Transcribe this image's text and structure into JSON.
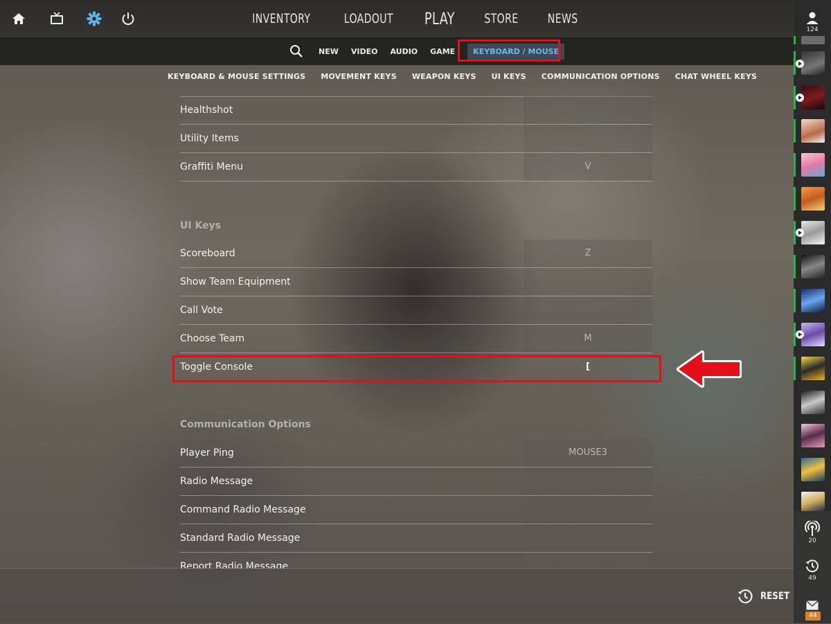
{
  "top_nav": {
    "items": [
      {
        "label": "INVENTORY"
      },
      {
        "label": "LOADOUT"
      },
      {
        "label": "PLAY"
      },
      {
        "label": "STORE"
      },
      {
        "label": "NEWS"
      }
    ],
    "left_icons": [
      "home-icon",
      "tv-icon",
      "gear-icon",
      "power-icon"
    ]
  },
  "settings_tabs": {
    "search_icon": "search-icon",
    "items": [
      "NEW",
      "VIDEO",
      "AUDIO",
      "GAME"
    ],
    "active": "KEYBOARD / MOUSE"
  },
  "sub_nav": [
    "KEYBOARD & MOUSE SETTINGS",
    "MOVEMENT KEYS",
    "WEAPON KEYS",
    "UI KEYS",
    "COMMUNICATION OPTIONS",
    "CHAT WHEEL KEYS"
  ],
  "rows_group1": [
    {
      "label": "Healthshot",
      "key": ""
    },
    {
      "label": "Utility Items",
      "key": ""
    },
    {
      "label": "Graffiti Menu",
      "key": "V"
    }
  ],
  "section_ui": "UI Keys",
  "rows_ui": [
    {
      "label": "Scoreboard",
      "key": "Z"
    },
    {
      "label": "Show Team Equipment",
      "key": ""
    },
    {
      "label": "Call Vote",
      "key": ""
    },
    {
      "label": "Choose Team",
      "key": "M"
    },
    {
      "label": "Toggle Console",
      "key": "["
    }
  ],
  "section_comm": "Communication Options",
  "rows_comm": [
    {
      "label": "Player Ping",
      "key": "MOUSE3"
    },
    {
      "label": "Radio Message",
      "key": ""
    },
    {
      "label": "Command Radio Message",
      "key": ""
    },
    {
      "label": "Standard Radio Message",
      "key": ""
    },
    {
      "label": "Report Radio Message",
      "key": ""
    }
  ],
  "reset": {
    "label": "RESET",
    "icon": "history-icon"
  },
  "sidebar": {
    "friends_count": "124",
    "broadcast_count": "20",
    "recent_count": "49",
    "mail_count": "44"
  },
  "colors": {
    "accent": "#6fb8e8",
    "highlight_annotation": "#e3101a",
    "online": "#2bb24c",
    "mail_badge": "#d9822b"
  }
}
